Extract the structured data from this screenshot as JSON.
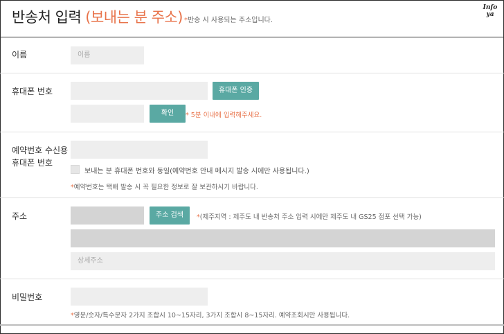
{
  "header": {
    "title": "반송처 입력",
    "title_accent": "(보내는 분 주소)",
    "note_star": "*",
    "note": "반송 시 사용되는 주소입니다.",
    "badge_line1": "Info",
    "badge_line2": "ya"
  },
  "name": {
    "label": "이름",
    "placeholder": "이름"
  },
  "phone": {
    "label": "휴대폰 번호",
    "verify_button": "휴대폰 인증",
    "confirm_button": "확인",
    "timer_note": "* 5분 이내에 입력해주세요."
  },
  "booking_phone": {
    "label_line1": "예약번호 수신용",
    "label_line2": "휴대폰 번호",
    "same_checkbox_label": "보내는 분 휴대폰 번호와 동일(예약번호 안내 메시지 발송 시에만 사용됩니다.)",
    "note_star": "*",
    "note": "예약번호는 택배 발송 시 꼭 필요한 정보로 잘 보관하시기 바랍니다."
  },
  "address": {
    "label": "주소",
    "search_button": "주소 검색",
    "note_star": "*",
    "note": "(제주지역 : 제주도 내 반송처 주소 입력 시에만 제주도 내 GS25 점포 선택 가능)",
    "detail_placeholder": "상세주소"
  },
  "password": {
    "label": "비밀번호",
    "note_star": "*",
    "note": "영문/숫자/특수문자 2가지 조합시 10~15자리, 3가지 조합시 8~15자리. 예약조회시만 사용됩니다."
  },
  "colors": {
    "accent_orange": "#e8734a",
    "button_teal": "#5aa9a3",
    "field_gray": "#eeeeee"
  }
}
